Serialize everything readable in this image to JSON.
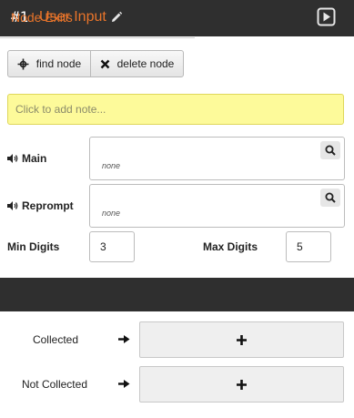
{
  "header": {
    "node_number": "#1",
    "title": "User Input",
    "edit_icon": "pencil-icon",
    "play_icon": "play-icon"
  },
  "toolbar": {
    "find_label": "find node",
    "find_icon": "crosshair-icon",
    "delete_label": "delete node",
    "delete_icon": "x-icon"
  },
  "note": {
    "placeholder": "Click to add note..."
  },
  "prompts": [
    {
      "label": "Main",
      "value": "none",
      "icon": "speaker-icon",
      "search_icon": "search-icon"
    },
    {
      "label": "Reprompt",
      "value": "none",
      "icon": "speaker-icon",
      "search_icon": "search-icon"
    }
  ],
  "digits": {
    "min_label": "Min Digits",
    "min_value": "3",
    "max_label": "Max Digits",
    "max_value": "5"
  },
  "exits": {
    "title": "Node Exits",
    "items": [
      {
        "label": "Collected",
        "arrow_icon": "arrow-right-icon",
        "add_icon": "plus-icon"
      },
      {
        "label": "Not Collected",
        "arrow_icon": "arrow-right-icon",
        "add_icon": "plus-icon"
      }
    ]
  },
  "colors": {
    "header_bg": "#2f2f2f",
    "accent": "#e8742a",
    "note_bg": "#fdfa9a"
  }
}
